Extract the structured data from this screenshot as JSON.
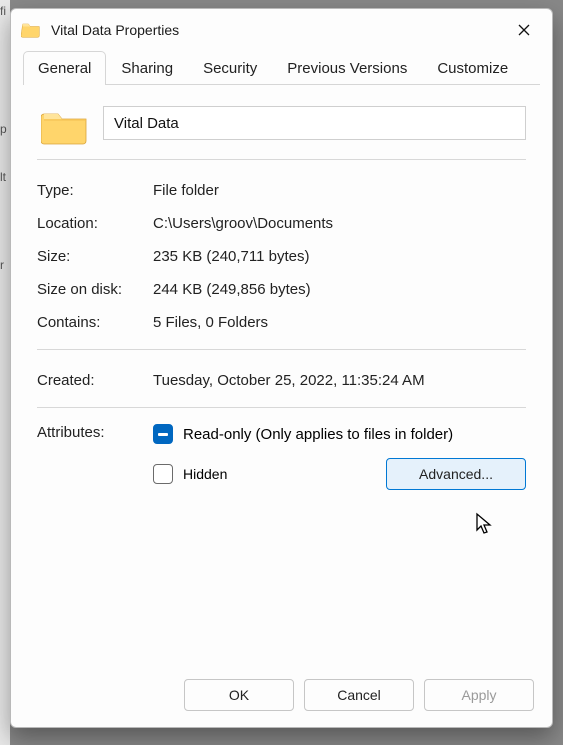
{
  "window": {
    "title": "Vital Data Properties"
  },
  "tabs": {
    "general": "General",
    "sharing": "Sharing",
    "security": "Security",
    "prev": "Previous Versions",
    "customize": "Customize"
  },
  "folder": {
    "name": "Vital Data"
  },
  "labels": {
    "type": "Type:",
    "location": "Location:",
    "size": "Size:",
    "size_on_disk": "Size on disk:",
    "contains": "Contains:",
    "created": "Created:",
    "attributes": "Attributes:"
  },
  "values": {
    "type": "File folder",
    "location": "C:\\Users\\groov\\Documents",
    "size": "235 KB (240,711 bytes)",
    "size_on_disk": "244 KB (249,856 bytes)",
    "contains": "5 Files, 0 Folders",
    "created": "Tuesday, October 25, 2022, 11:35:24 AM"
  },
  "attributes": {
    "readonly_label": "Read-only (Only applies to files in folder)",
    "hidden_label": "Hidden",
    "advanced_label": "Advanced..."
  },
  "buttons": {
    "ok": "OK",
    "cancel": "Cancel",
    "apply": "Apply"
  }
}
